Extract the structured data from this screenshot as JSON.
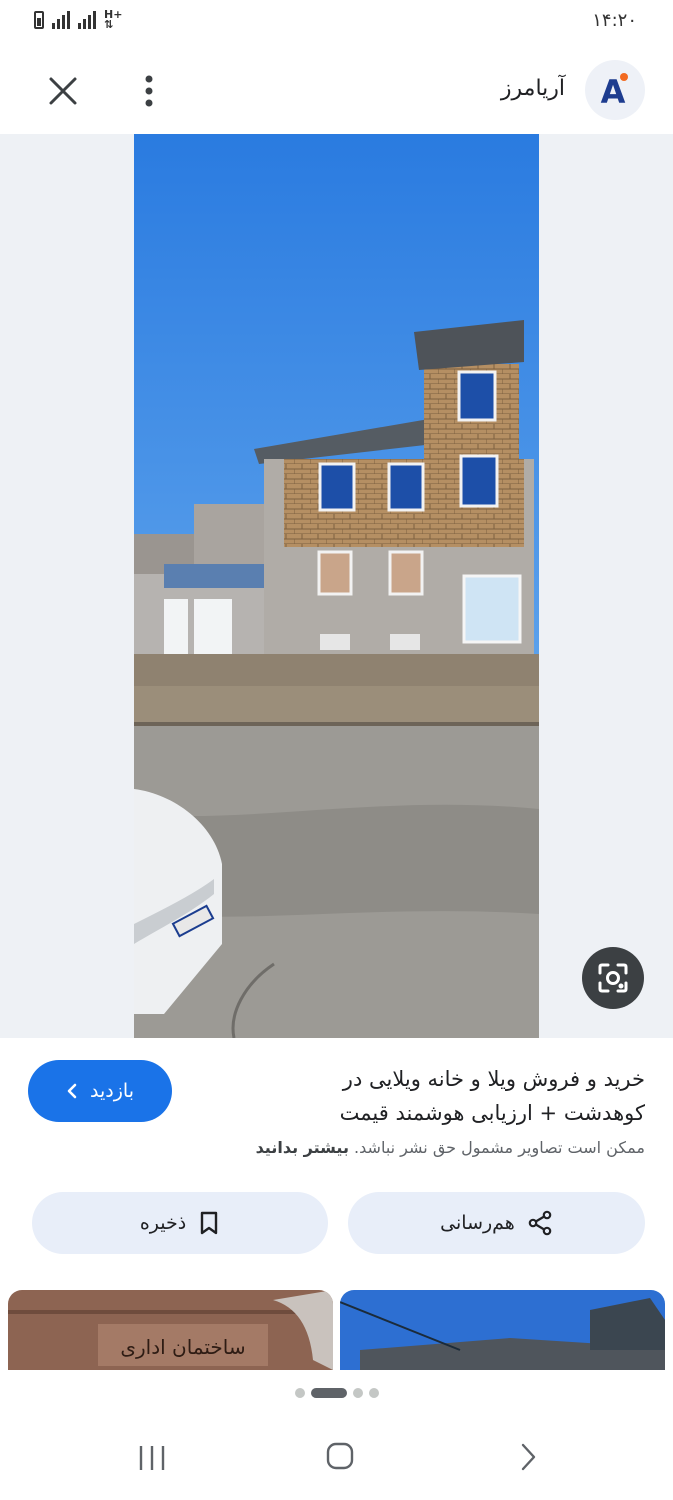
{
  "status_bar": {
    "time": "۱۴:۲۰",
    "network_type": "H+",
    "icons": [
      "battery-icon",
      "signal-icon",
      "signal-icon",
      "data-arrows-icon"
    ]
  },
  "header": {
    "site_name": "آریامرز",
    "site_logo_text": "A",
    "icons": [
      "close-icon",
      "more-vert-icon"
    ]
  },
  "result": {
    "title": "خرید و فروش ویلا و خانه ویلایی در کوهدشت + ارزیابی هوشمند قیمت",
    "visit_label": "بازدید",
    "copyright_text": "ممکن است تصاویر مشمول حق نشر نباشد.",
    "copyright_link": "بیشتر بدانید"
  },
  "actions": {
    "share_label": "هم‌رسانی",
    "save_label": "ذخیره"
  },
  "thumbnails": {
    "left_sign_text": "ساختمان اداری"
  },
  "pagination": {
    "count": 4,
    "active_index": 1
  },
  "colors": {
    "accent": "#1a73e8",
    "action_bg": "#e8eef9",
    "viewer_bg": "#eef1f5",
    "sky": "#2a7be0"
  }
}
